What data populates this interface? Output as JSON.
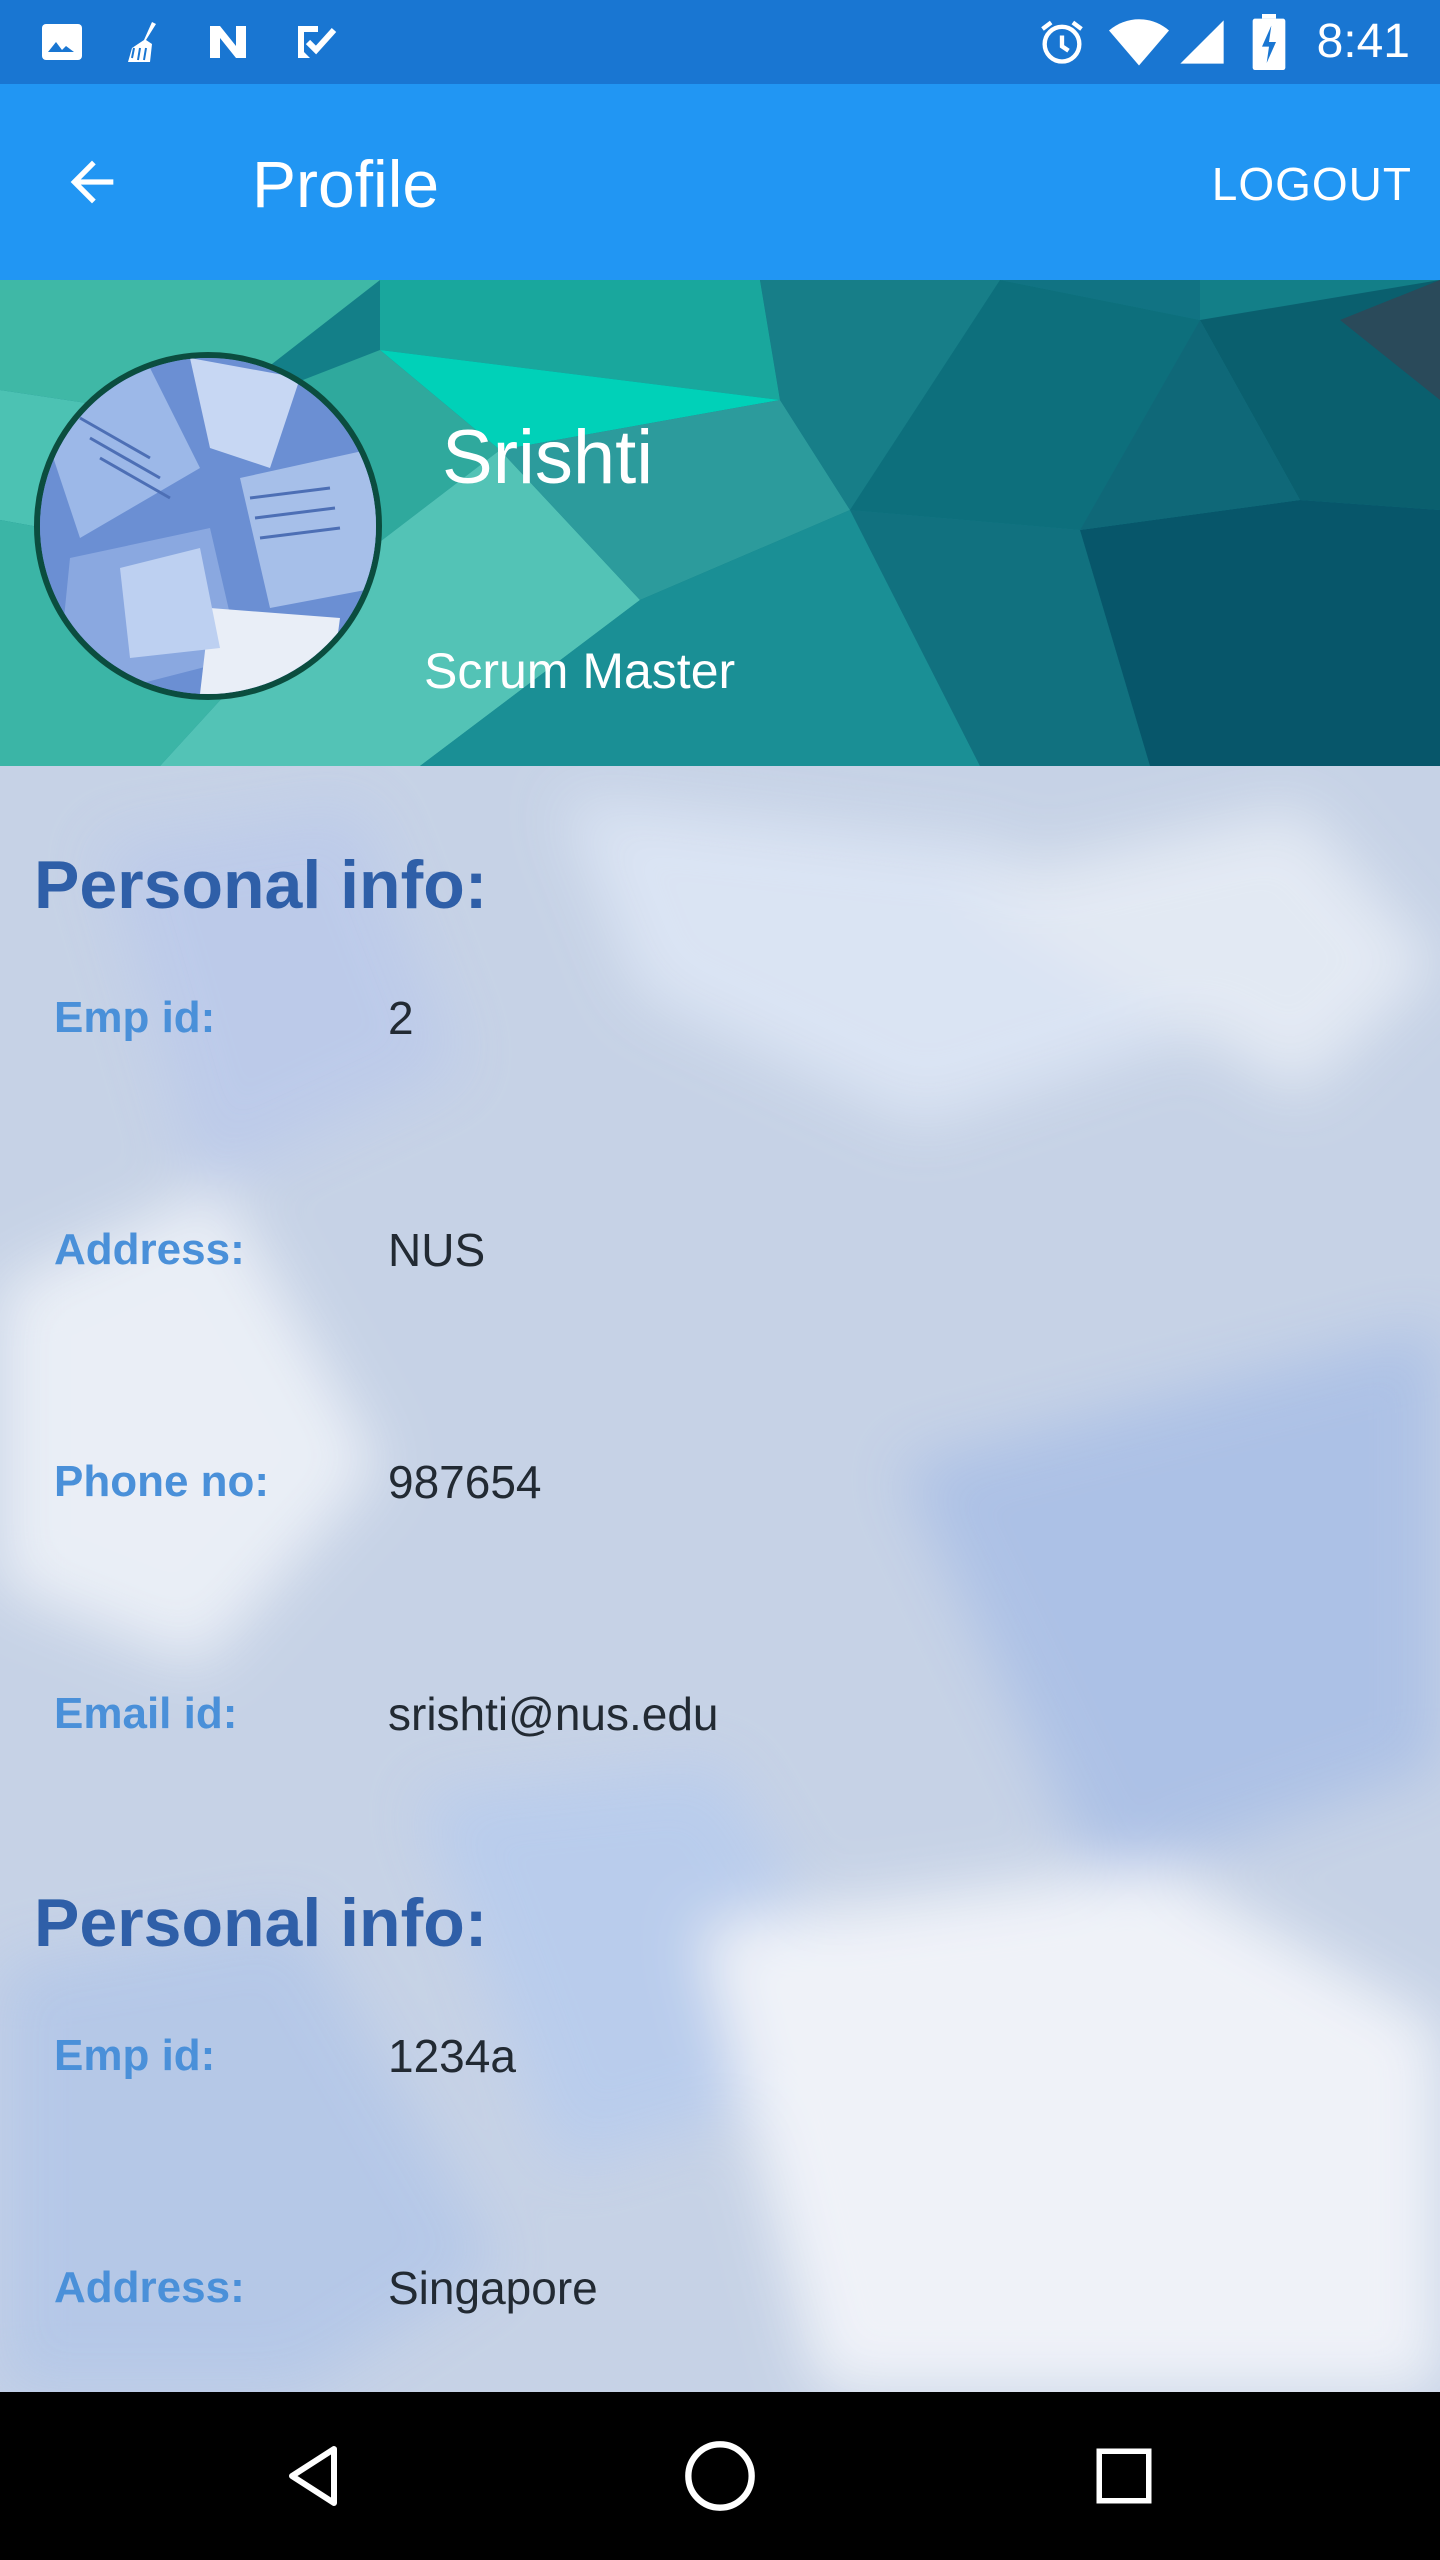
{
  "status_bar": {
    "time": "8:41",
    "left_icons": [
      "image-icon",
      "broom-icon",
      "n-app-icon",
      "checklist-icon"
    ],
    "right_icons": [
      "alarm-icon",
      "wifi-icon",
      "signal-icon",
      "battery-charging-icon"
    ]
  },
  "app_bar": {
    "title": "Profile",
    "logout_label": "LOGOUT",
    "back_icon": "arrow-back-icon"
  },
  "profile": {
    "name": "Srishti",
    "role": "Scrum Master"
  },
  "sections": [
    {
      "title": "Personal info:",
      "fields": [
        {
          "label": "Emp id:",
          "value": "2"
        },
        {
          "label": "Address:",
          "value": "NUS"
        },
        {
          "label": "Phone no:",
          "value": "987654"
        },
        {
          "label": "Email id:",
          "value": "srishti@nus.edu"
        }
      ]
    },
    {
      "title": "Personal info:",
      "fields": [
        {
          "label": "Emp id:",
          "value": "1234a"
        },
        {
          "label": "Address:",
          "value": "Singapore"
        }
      ]
    }
  ],
  "nav_bar": {
    "icons": [
      "back-triangle-icon",
      "home-circle-icon",
      "recents-square-icon"
    ]
  },
  "colors": {
    "status_bar": "#1976D2",
    "app_bar": "#2196F3",
    "section_title": "#2f5fa8",
    "field_label": "#4a90d9",
    "field_value": "#222a33"
  }
}
